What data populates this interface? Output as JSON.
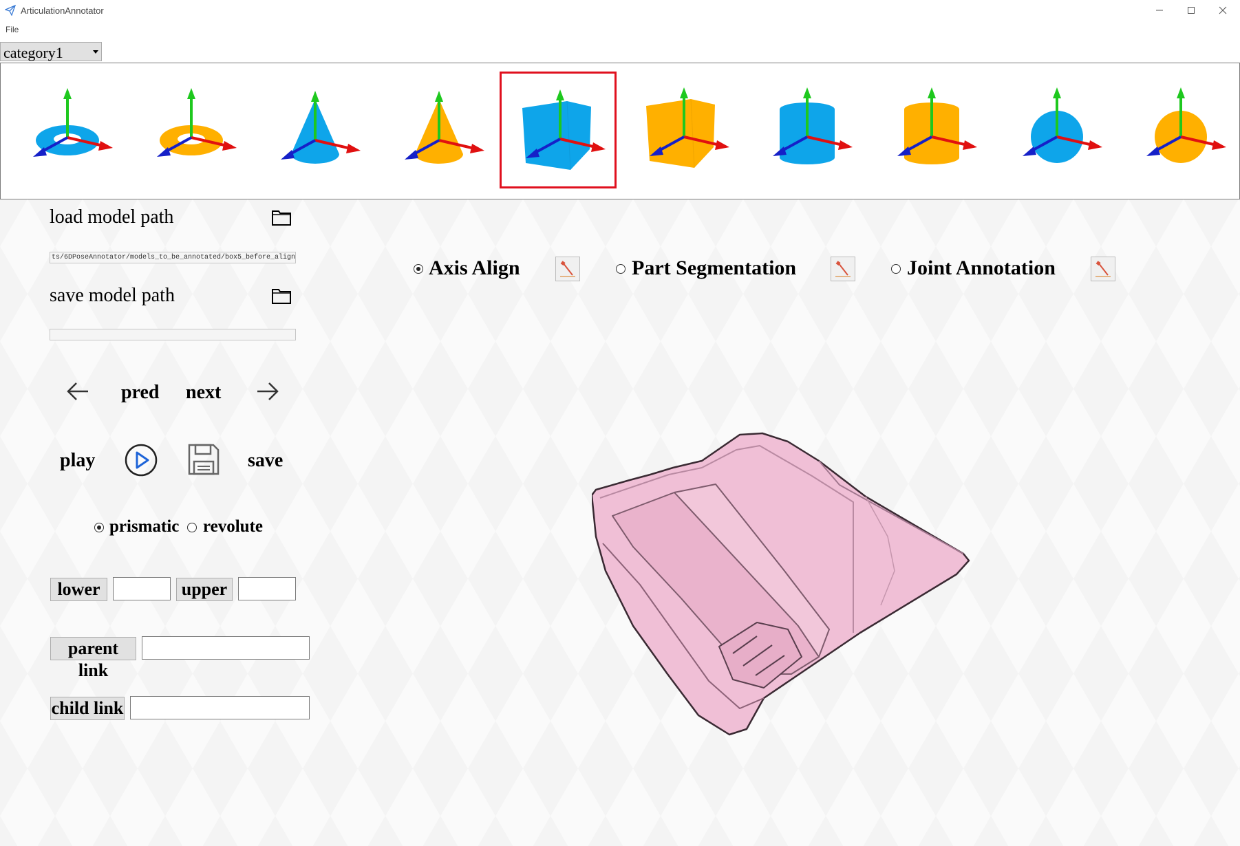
{
  "window": {
    "title": "ArticulationAnnotator"
  },
  "menu": {
    "file": "File"
  },
  "category": {
    "selected": "category1"
  },
  "thumbnails": [
    {
      "shape": "torus",
      "color": "#0ea5ea"
    },
    {
      "shape": "torus",
      "color": "#ffb000"
    },
    {
      "shape": "cone",
      "color": "#0ea5ea"
    },
    {
      "shape": "cone",
      "color": "#ffb000"
    },
    {
      "shape": "cube",
      "color": "#0ea5ea",
      "selected": true
    },
    {
      "shape": "cube",
      "color": "#ffb000"
    },
    {
      "shape": "cylinder",
      "color": "#0ea5ea"
    },
    {
      "shape": "cylinder",
      "color": "#ffb000"
    },
    {
      "shape": "sphere",
      "color": "#0ea5ea"
    },
    {
      "shape": "sphere",
      "color": "#ffb000"
    }
  ],
  "load": {
    "label": "load model path",
    "path": "ts/6DPoseAnnotator/models_to_be_annotated/box5_before_align"
  },
  "save_path": {
    "label": "save model path",
    "path": ""
  },
  "nav": {
    "pred": "pred",
    "next": "next"
  },
  "playback": {
    "play": "play",
    "save": "save"
  },
  "joint_type": {
    "prismatic": "prismatic",
    "revolute": "revolute",
    "selected": "prismatic"
  },
  "limits": {
    "lower_label": "lower",
    "upper_label": "upper",
    "lower_value": "",
    "upper_value": ""
  },
  "links": {
    "parent_label": "parent link",
    "child_label": "child link",
    "parent_value": "",
    "child_value": ""
  },
  "modes": [
    {
      "label": "Axis Align",
      "selected": true
    },
    {
      "label": "Part Segmentation",
      "selected": false
    },
    {
      "label": "Joint Annotation",
      "selected": false
    }
  ],
  "colors": {
    "model": "#f0bfd6",
    "selection": "#e0101e",
    "blue": "#0ea5ea",
    "orange": "#ffb000"
  }
}
